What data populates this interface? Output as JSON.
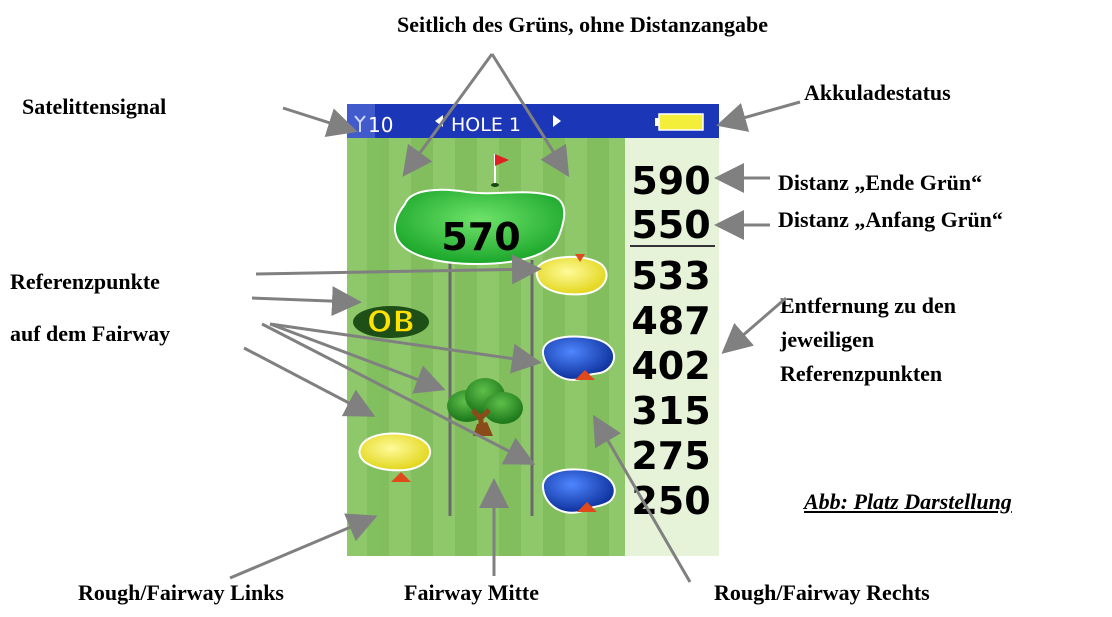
{
  "title": "Seitlich des Grüns, ohne Distanzangabe",
  "labels": {
    "satellite": "Satelittensignal",
    "battery": "Akkuladestatus",
    "dist_end": "Distanz „Ende Grün“",
    "dist_start": "Distanz „Anfang Grün“",
    "reference_line1": "Referenzpunkte",
    "reference_line2": "auf dem Fairway",
    "distances_to_refs": "Entfernung zu den jeweiligen Referenzpunkten",
    "rough_left": "Rough/Fairway Links",
    "fairway_mid": "Fairway Mitte",
    "rough_right": "Rough/Fairway Rechts",
    "caption": "Abb: Platz Darstellung"
  },
  "device": {
    "satellite_count": "10",
    "hole_label": "HOLE 1",
    "green_distance": "570",
    "ob_label": "OB",
    "green_end": "590",
    "green_start": "550",
    "ref_distances": [
      "533",
      "487",
      "402",
      "315",
      "275",
      "250"
    ],
    "colors": {
      "header": "#1c36b8",
      "grass_light": "#8ec86a",
      "grass_dark": "#79b857",
      "green": "#2fbf3a",
      "sand": "#f2ea3a",
      "water": "#1f4fc8",
      "panel": "#e6f3d8",
      "battery": "#f3ee3a"
    }
  }
}
